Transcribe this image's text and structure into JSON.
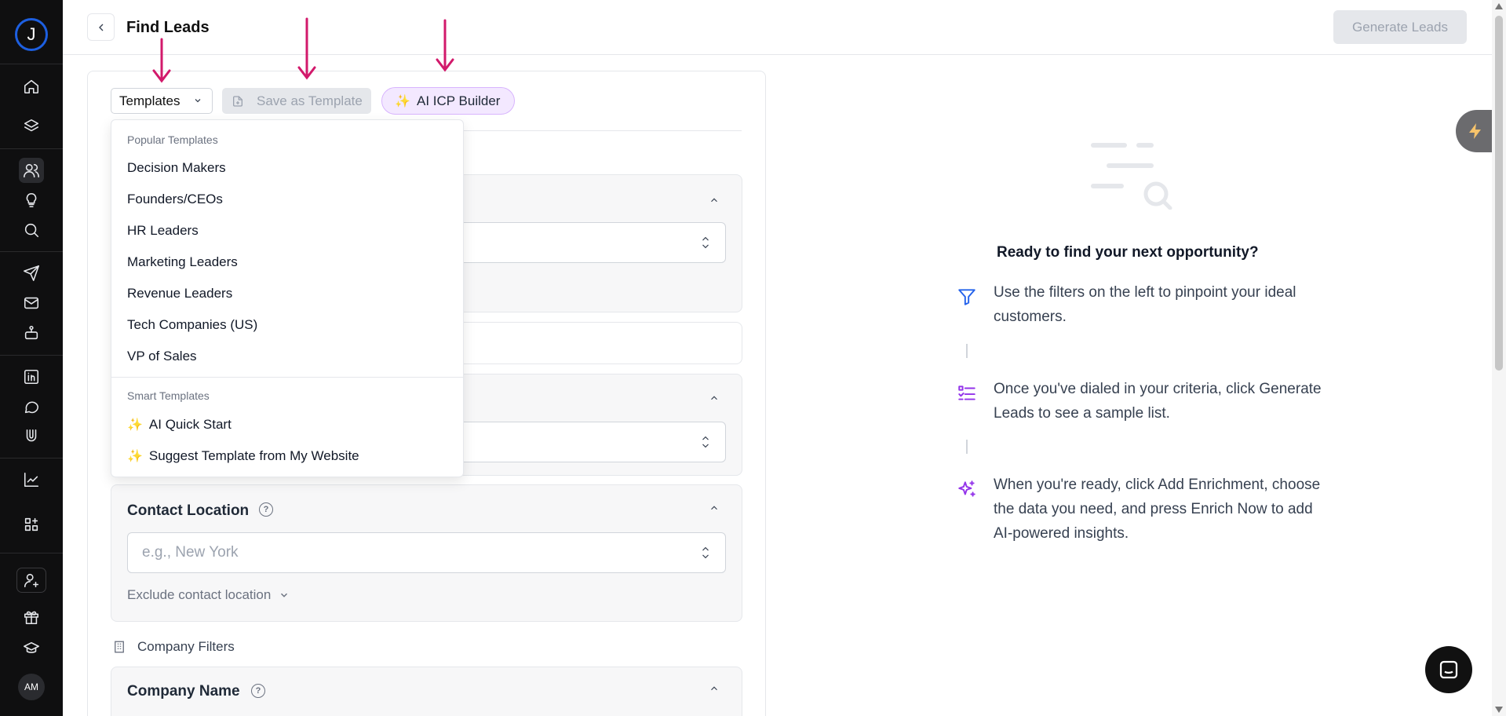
{
  "sidebar": {
    "logo": "J",
    "avatar": "AM",
    "icons": [
      "home-icon",
      "layers-icon",
      "users-icon",
      "lightbulb-icon",
      "search-icon",
      "send-icon",
      "mail-icon",
      "robot-icon",
      "linkedin-icon",
      "chat-icon",
      "magnet-icon",
      "chart-icon",
      "apps-icon",
      "add-user-icon",
      "gift-icon",
      "graduation-cap-icon"
    ]
  },
  "header": {
    "title": "Find Leads",
    "generate_label": "Generate Leads"
  },
  "toolbar": {
    "templates_label": "Templates",
    "save_template_label": "Save as Template",
    "ai_icp_label": "AI ICP Builder"
  },
  "dropdown": {
    "popular_heading": "Popular Templates",
    "popular": [
      "Decision Makers",
      "Founders/CEOs",
      "HR Leaders",
      "Marketing Leaders",
      "Revenue Leaders",
      "Tech Companies (US)",
      "VP of Sales"
    ],
    "smart_heading": "Smart Templates",
    "smart": [
      "AI Quick Start",
      "Suggest Template from My Website"
    ]
  },
  "filters": {
    "contact_location_title": "Contact Location",
    "contact_location_placeholder": "e.g., New York",
    "exclude_label": "Exclude contact location",
    "company_filters_label": "Company Filters",
    "company_name_title": "Company Name"
  },
  "empty_state": {
    "title": "Ready to find your next opportunity?",
    "steps": [
      "Use the filters on the left to pinpoint your ideal customers.",
      "Once you've dialed in your criteria, click Generate Leads to see a sample list.",
      "When you're ready, click Add Enrichment, choose the data you need, and press Enrich Now to add AI-powered insights."
    ]
  },
  "colors": {
    "annotation_arrow": "#d2196b",
    "accent_purple": "#9333ea",
    "accent_blue": "#2563eb",
    "sparkle": "#f59e0b"
  }
}
